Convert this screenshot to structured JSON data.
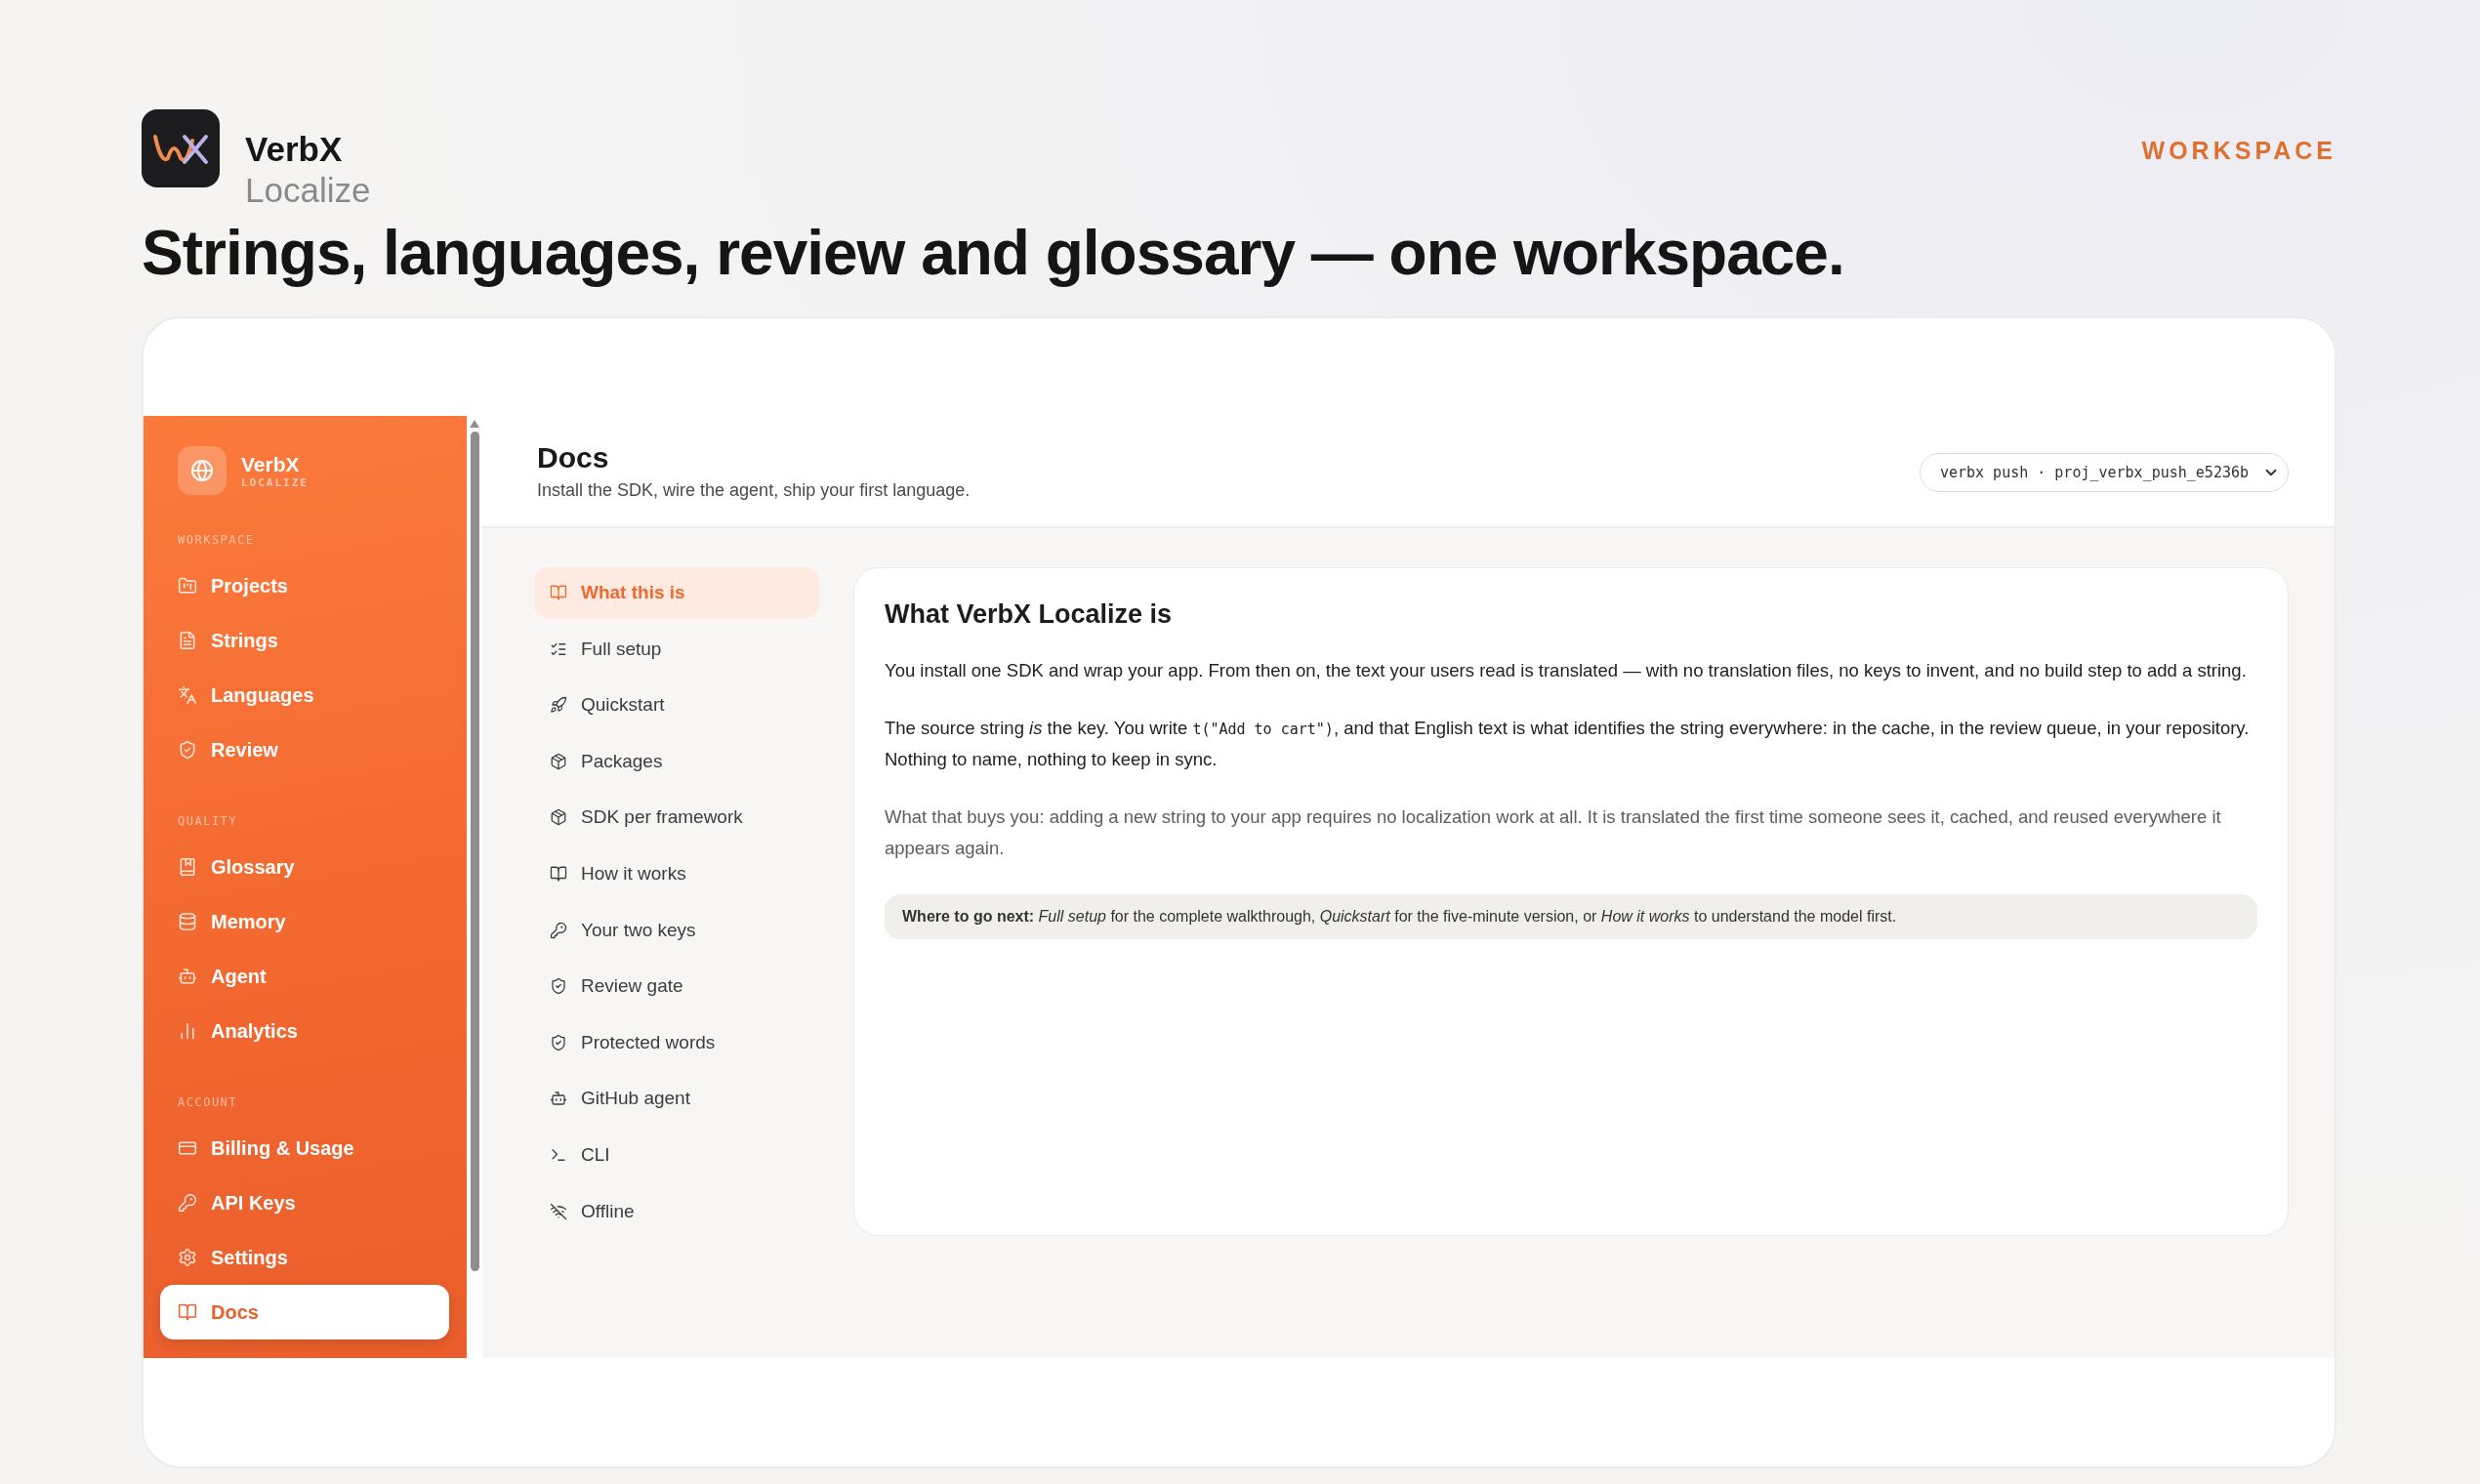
{
  "brand": {
    "name": "VerbX",
    "product": "Localize"
  },
  "top_label": "WORKSPACE",
  "headline": "Strings, languages, review and glossary — one workspace.",
  "app": {
    "sidebar": {
      "brand": {
        "name": "VerbX",
        "product": "LOCALIZE"
      },
      "sections": [
        {
          "label": "WORKSPACE",
          "items": [
            {
              "label": "Projects",
              "selected": false
            },
            {
              "label": "Strings",
              "selected": false
            },
            {
              "label": "Languages",
              "selected": false
            },
            {
              "label": "Review",
              "selected": false
            }
          ]
        },
        {
          "label": "QUALITY",
          "items": [
            {
              "label": "Glossary",
              "selected": false
            },
            {
              "label": "Memory",
              "selected": false
            },
            {
              "label": "Agent",
              "selected": false
            },
            {
              "label": "Analytics",
              "selected": false
            }
          ]
        },
        {
          "label": "ACCOUNT",
          "items": [
            {
              "label": "Billing & Usage",
              "selected": false
            },
            {
              "label": "API Keys",
              "selected": false
            },
            {
              "label": "Settings",
              "selected": false
            },
            {
              "label": "Docs",
              "selected": true
            }
          ]
        }
      ]
    },
    "header": {
      "title": "Docs",
      "subtitle": "Install the SDK, wire the agent, ship your first language.",
      "project_select": {
        "value": "verbx push · proj_verbx_push_e5236b"
      }
    },
    "docs_nav": [
      {
        "label": "What this is",
        "selected": true
      },
      {
        "label": "Full setup",
        "selected": false
      },
      {
        "label": "Quickstart",
        "selected": false
      },
      {
        "label": "Packages",
        "selected": false
      },
      {
        "label": "SDK per framework",
        "selected": false
      },
      {
        "label": "How it works",
        "selected": false
      },
      {
        "label": "Your two keys",
        "selected": false
      },
      {
        "label": "Review gate",
        "selected": false
      },
      {
        "label": "Protected words",
        "selected": false
      },
      {
        "label": "GitHub agent",
        "selected": false
      },
      {
        "label": "CLI",
        "selected": false
      },
      {
        "label": "Offline",
        "selected": false
      }
    ],
    "article": {
      "title": "What VerbX Localize is",
      "paragraphs": [
        {
          "muted": false,
          "segments": [
            {
              "kind": "text",
              "text": "You install one SDK and wrap your app. From then on, the text your users read is translated — with no translation files, no keys to invent, and no build step to add a string."
            }
          ]
        },
        {
          "muted": false,
          "segments": [
            {
              "kind": "text",
              "text": "The source string *is* the key. You write "
            },
            {
              "kind": "code",
              "text": "t(\"Add to cart\")"
            },
            {
              "kind": "text",
              "text": ", and that English text is what identifies the string everywhere: in the cache, in the review queue, in your repository. Nothing to name, nothing to keep in sync."
            }
          ]
        },
        {
          "muted": true,
          "segments": [
            {
              "kind": "text",
              "text": "What that buys you: adding a new string to your app requires no localization work at all. It is translated the first time someone sees it, cached, and reused everywhere it appears again."
            }
          ]
        }
      ],
      "callout": "**Where to go next:** *Full setup* for the complete walkthrough, *Quickstart* for the five-minute version, or *How it works* to understand the model first."
    }
  }
}
